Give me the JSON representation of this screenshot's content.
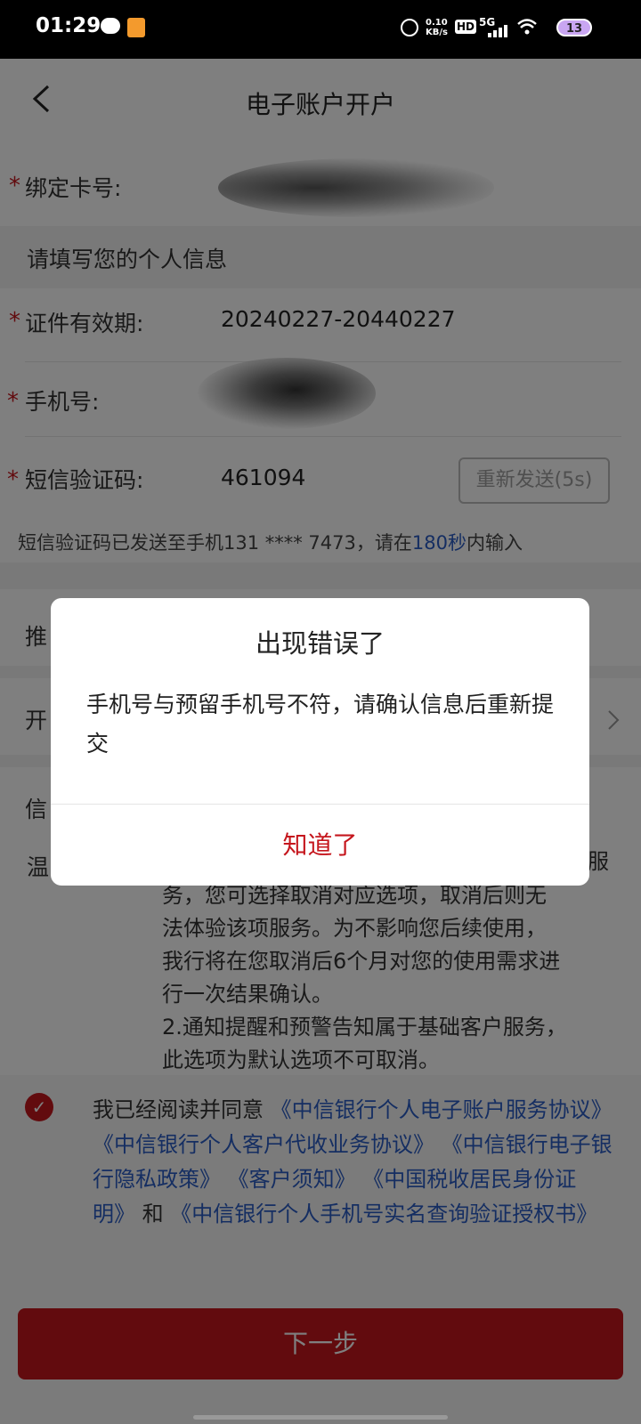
{
  "status_bar": {
    "time": "01:29",
    "net_speed": "0.10\nKB/s",
    "hd_label": "HD",
    "network": "5G",
    "battery": "13"
  },
  "header": {
    "title": "电子账户开户",
    "back_icon": "chevron-left-icon"
  },
  "form": {
    "card_label": "绑定卡号:",
    "section_title": "请填写您的个人信息",
    "id_validity_label": "证件有效期:",
    "id_validity_value": "20240227-20440227",
    "phone_label": "手机号:",
    "sms_label": "短信验证码:",
    "sms_value": "461094",
    "resend_label": "重新发送(5s)",
    "hint_prefix": "短信验证码已发送至手机131 **** 7473，请在",
    "hint_time": "180秒",
    "hint_suffix": "内输入",
    "required_mark": "*",
    "row_recommend": "推",
    "row_open": "开",
    "row_info": "信",
    "row_warm": "温"
  },
  "notice": {
    "line_a_tail": "服",
    "lines": [
      "务，您可选择取消对应选项，取消后则无",
      "法体验该项服务。为不影响您后续使用，",
      "我行将在您取消后6个月对您的使用需求进",
      "行一次结果确认。",
      "2.通知提醒和预警告知属于基础客户服务，",
      "此选项为默认选项不可取消。"
    ]
  },
  "agreement": {
    "prefix": "我已经阅读并同意",
    "link1": "《中信银行个人电子账户服务协议》",
    "link2": "《中信银行个人客户代收业务协议》",
    "link3": "《中信银行电子银行隐私政策》",
    "link4": "《客户须知》",
    "link5": "《中国税收居民身份证明》",
    "joiner": "和",
    "link6": "《中信银行个人手机号实名查询验证授权书》"
  },
  "next_button": "下一步",
  "dialog": {
    "title": "出现错误了",
    "message": "手机号与预留手机号不符，请确认信息后重新提交",
    "ok_button": "知道了"
  },
  "colors": {
    "brand_red": "#c5161d",
    "link_blue": "#2b5cc4"
  }
}
